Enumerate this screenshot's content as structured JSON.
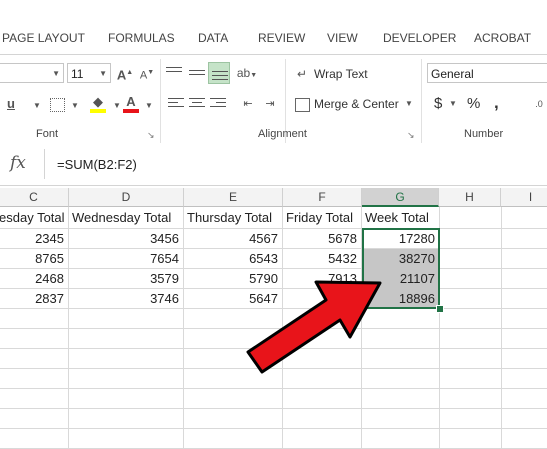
{
  "ribbon_tabs": [
    "PAGE LAYOUT",
    "FORMULAS",
    "DATA",
    "REVIEW",
    "VIEW",
    "DEVELOPER",
    "ACROBAT"
  ],
  "ribbon": {
    "font_size": "11",
    "wrap_text": "Wrap Text",
    "merge_center": "Merge & Center",
    "number_format": "General",
    "currency": "$",
    "percent": "%",
    "comma": ",",
    "groups": {
      "font": "Font",
      "alignment": "Alignment",
      "number": "Number"
    }
  },
  "formula_bar": {
    "fx": "fx",
    "formula": "=SUM(B2:F2)"
  },
  "columns": [
    "C",
    "D",
    "E",
    "F",
    "G",
    "H",
    "I"
  ],
  "selected_column": "G",
  "sheet": {
    "headers": [
      "esday Total",
      "Wednesday Total",
      "Thursday Total",
      "Friday Total",
      "Week Total"
    ],
    "rows": [
      [
        "2345",
        "3456",
        "4567",
        "5678",
        "17280"
      ],
      [
        "8765",
        "7654",
        "6543",
        "5432",
        "38270"
      ],
      [
        "2468",
        "3579",
        "5790",
        "7913",
        "21107"
      ],
      [
        "2837",
        "3746",
        "5647",
        "",
        "18896"
      ]
    ]
  },
  "colors": {
    "accent_green": "#217346",
    "arrow_red": "#e8141a",
    "selection_gray": "#c6c6c6"
  }
}
